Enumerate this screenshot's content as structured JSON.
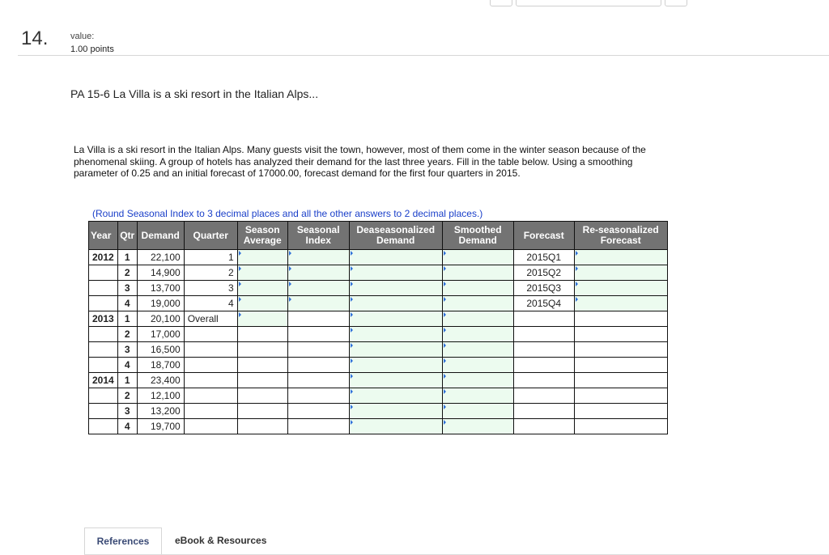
{
  "question": {
    "number": "14.",
    "value_label": "value:",
    "points": "1.00 points"
  },
  "problem": {
    "title": "PA 15-6 La Villa is a ski resort in the Italian Alps...",
    "text": "La Villa is a ski resort in the Italian Alps. Many guests visit the town, however, most of them come in the winter season because of the phenomenal skiing. A group of hotels has analyzed their demand for the last three years. Fill in the table below. Using a smoothing parameter of 0.25 and an initial forecast of 17000.00, forecast demand for the first four quarters in 2015.",
    "note": "(Round Seasonal Index to 3 decimal places and all the other answers to 2 decimal places.)"
  },
  "table": {
    "headers": {
      "year": "Year",
      "qtr": "Qtr",
      "demand": "Demand",
      "quarter": "Quarter",
      "season_average_1": "Season",
      "season_average_2": "Average",
      "seasonal_index_1": "Seasonal",
      "seasonal_index_2": "Index",
      "deseasonalized_1": "Deaseasonalized",
      "deseasonalized_2": "Demand",
      "smoothed_1": "Smoothed",
      "smoothed_2": "Demand",
      "forecast": "Forecast",
      "reseasonalized_1": "Re-seasonalized",
      "reseasonalized_2": "Forecast"
    },
    "rows": [
      {
        "year": "2012",
        "qtr": "1",
        "demand": "22,100",
        "quarter": "1",
        "forecast": "2015Q1"
      },
      {
        "year": "",
        "qtr": "2",
        "demand": "14,900",
        "quarter": "2",
        "forecast": "2015Q2"
      },
      {
        "year": "",
        "qtr": "3",
        "demand": "13,700",
        "quarter": "3",
        "forecast": "2015Q3"
      },
      {
        "year": "",
        "qtr": "4",
        "demand": "19,000",
        "quarter": "4",
        "forecast": "2015Q4"
      },
      {
        "year": "2013",
        "qtr": "1",
        "demand": "20,100",
        "quarter": "Overall",
        "forecast": ""
      },
      {
        "year": "",
        "qtr": "2",
        "demand": "17,000",
        "quarter": "",
        "forecast": ""
      },
      {
        "year": "",
        "qtr": "3",
        "demand": "16,500",
        "quarter": "",
        "forecast": ""
      },
      {
        "year": "",
        "qtr": "4",
        "demand": "18,700",
        "quarter": "",
        "forecast": ""
      },
      {
        "year": "2014",
        "qtr": "1",
        "demand": "23,400",
        "quarter": "",
        "forecast": ""
      },
      {
        "year": "",
        "qtr": "2",
        "demand": "12,100",
        "quarter": "",
        "forecast": ""
      },
      {
        "year": "",
        "qtr": "3",
        "demand": "13,200",
        "quarter": "",
        "forecast": ""
      },
      {
        "year": "",
        "qtr": "4",
        "demand": "19,700",
        "quarter": "",
        "forecast": ""
      }
    ]
  },
  "tabs": {
    "references": "References",
    "ebook": "eBook & Resources"
  },
  "colors": {
    "header_bg": "#737373",
    "input_bg": "#ecfbef",
    "note_text": "#1a3fc9"
  }
}
